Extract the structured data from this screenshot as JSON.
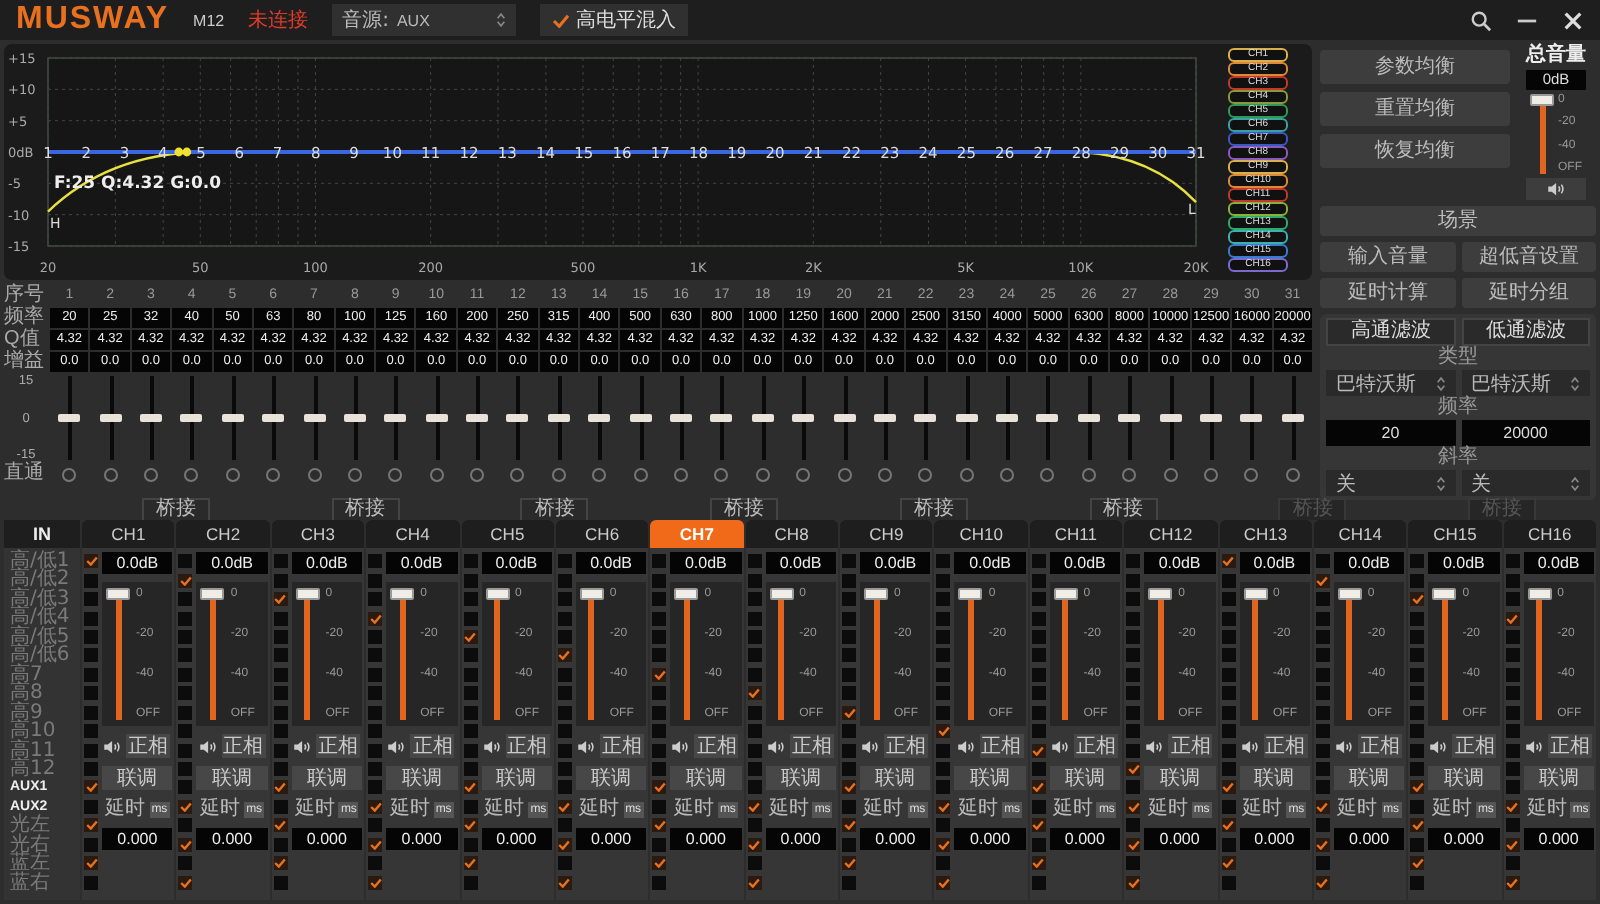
{
  "header": {
    "logo": "MUSWAY",
    "model": "M12",
    "status": "未连接",
    "source": {
      "label": "音源:",
      "value": "AUX"
    },
    "high_level_mix": {
      "label": "高电平混入",
      "checked": true
    }
  },
  "graph": {
    "y_labels": [
      "+15",
      "+10",
      "+5",
      "0dB",
      "-5",
      "-10",
      "-15"
    ],
    "x_labels": [
      "20",
      "50",
      "100",
      "200",
      "500",
      "1K",
      "2K",
      "5K",
      "10K",
      "20K"
    ],
    "readout": "F:25 Q:4.32 G:0.0",
    "hpf_marker": "H",
    "lpf_marker": "L",
    "band_labels": [
      "1",
      "2",
      "3",
      "4",
      "5",
      "6",
      "7",
      "8",
      "9",
      "10",
      "11",
      "12",
      "13",
      "14",
      "15",
      "16",
      "17",
      "18",
      "19",
      "20",
      "21",
      "22",
      "23",
      "24",
      "25",
      "26",
      "27",
      "28",
      "29",
      "30",
      "31"
    ]
  },
  "channel_legend": [
    {
      "label": "CH1",
      "color": "#d8b04a"
    },
    {
      "label": "CH2",
      "color": "#e0883a"
    },
    {
      "label": "CH3",
      "color": "#c0392b"
    },
    {
      "label": "CH4",
      "color": "#8a9a3a"
    },
    {
      "label": "CH5",
      "color": "#2e9a5a"
    },
    {
      "label": "CH6",
      "color": "#3aa0a0"
    },
    {
      "label": "CH7",
      "color": "#3a5ac0"
    },
    {
      "label": "CH8",
      "color": "#8a5ac0"
    },
    {
      "label": "CH9",
      "color": "#d8b04a"
    },
    {
      "label": "CH10",
      "color": "#e0883a"
    },
    {
      "label": "CH11",
      "color": "#c0392b"
    },
    {
      "label": "CH12",
      "color": "#8ab03a"
    },
    {
      "label": "CH13",
      "color": "#2eaa6a"
    },
    {
      "label": "CH14",
      "color": "#3ab0b0"
    },
    {
      "label": "CH15",
      "color": "#3a7ad0"
    },
    {
      "label": "CH16",
      "color": "#7a6ad0"
    }
  ],
  "eq_actions": [
    "参数均衡",
    "重置均衡",
    "恢复均衡"
  ],
  "master_volume": {
    "title": "总音量",
    "reading": "0dB",
    "level": 1,
    "scale": [
      "0",
      "-20",
      "-40",
      "OFF"
    ]
  },
  "scene_button": "场景",
  "tool_buttons": [
    "输入音量",
    "超低音设置",
    "延时计算",
    "延时分组"
  ],
  "filter": {
    "tabs": [
      "高通滤波",
      "低通滤波"
    ],
    "type_label": "类型",
    "types": [
      "巴特沃斯",
      "巴特沃斯"
    ],
    "freq_label": "频率",
    "freqs": [
      "20",
      "20000"
    ],
    "slope_label": "斜率",
    "slopes": [
      "关",
      "关"
    ]
  },
  "eq_table": {
    "row_labels": [
      "序号",
      "频率",
      "Q值",
      "增益"
    ],
    "scale": [
      "15",
      "0",
      "-15"
    ],
    "bypass_label": "直通",
    "bands": [
      {
        "number": "1",
        "freq": "20",
        "q": "4.32",
        "gain": "0.0",
        "level": 0.5,
        "bypass": false
      },
      {
        "number": "2",
        "freq": "25",
        "q": "4.32",
        "gain": "0.0",
        "level": 0.5,
        "bypass": false
      },
      {
        "number": "3",
        "freq": "32",
        "q": "4.32",
        "gain": "0.0",
        "level": 0.5,
        "bypass": false
      },
      {
        "number": "4",
        "freq": "40",
        "q": "4.32",
        "gain": "0.0",
        "level": 0.5,
        "bypass": false
      },
      {
        "number": "5",
        "freq": "50",
        "q": "4.32",
        "gain": "0.0",
        "level": 0.5,
        "bypass": false
      },
      {
        "number": "6",
        "freq": "63",
        "q": "4.32",
        "gain": "0.0",
        "level": 0.5,
        "bypass": false
      },
      {
        "number": "7",
        "freq": "80",
        "q": "4.32",
        "gain": "0.0",
        "level": 0.5,
        "bypass": false
      },
      {
        "number": "8",
        "freq": "100",
        "q": "4.32",
        "gain": "0.0",
        "level": 0.5,
        "bypass": false
      },
      {
        "number": "9",
        "freq": "125",
        "q": "4.32",
        "gain": "0.0",
        "level": 0.5,
        "bypass": false
      },
      {
        "number": "10",
        "freq": "160",
        "q": "4.32",
        "gain": "0.0",
        "level": 0.5,
        "bypass": false
      },
      {
        "number": "11",
        "freq": "200",
        "q": "4.32",
        "gain": "0.0",
        "level": 0.5,
        "bypass": false
      },
      {
        "number": "12",
        "freq": "250",
        "q": "4.32",
        "gain": "0.0",
        "level": 0.5,
        "bypass": false
      },
      {
        "number": "13",
        "freq": "315",
        "q": "4.32",
        "gain": "0.0",
        "level": 0.5,
        "bypass": false
      },
      {
        "number": "14",
        "freq": "400",
        "q": "4.32",
        "gain": "0.0",
        "level": 0.5,
        "bypass": false
      },
      {
        "number": "15",
        "freq": "500",
        "q": "4.32",
        "gain": "0.0",
        "level": 0.5,
        "bypass": false
      },
      {
        "number": "16",
        "freq": "630",
        "q": "4.32",
        "gain": "0.0",
        "level": 0.5,
        "bypass": false
      },
      {
        "number": "17",
        "freq": "800",
        "q": "4.32",
        "gain": "0.0",
        "level": 0.5,
        "bypass": false
      },
      {
        "number": "18",
        "freq": "1000",
        "q": "4.32",
        "gain": "0.0",
        "level": 0.5,
        "bypass": false
      },
      {
        "number": "19",
        "freq": "1250",
        "q": "4.32",
        "gain": "0.0",
        "level": 0.5,
        "bypass": false
      },
      {
        "number": "20",
        "freq": "1600",
        "q": "4.32",
        "gain": "0.0",
        "level": 0.5,
        "bypass": false
      },
      {
        "number": "21",
        "freq": "2000",
        "q": "4.32",
        "gain": "0.0",
        "level": 0.5,
        "bypass": false
      },
      {
        "number": "22",
        "freq": "2500",
        "q": "4.32",
        "gain": "0.0",
        "level": 0.5,
        "bypass": false
      },
      {
        "number": "23",
        "freq": "3150",
        "q": "4.32",
        "gain": "0.0",
        "level": 0.5,
        "bypass": false
      },
      {
        "number": "24",
        "freq": "4000",
        "q": "4.32",
        "gain": "0.0",
        "level": 0.5,
        "bypass": false
      },
      {
        "number": "25",
        "freq": "5000",
        "q": "4.32",
        "gain": "0.0",
        "level": 0.5,
        "bypass": false
      },
      {
        "number": "26",
        "freq": "6300",
        "q": "4.32",
        "gain": "0.0",
        "level": 0.5,
        "bypass": false
      },
      {
        "number": "27",
        "freq": "8000",
        "q": "4.32",
        "gain": "0.0",
        "level": 0.5,
        "bypass": false
      },
      {
        "number": "28",
        "freq": "10000",
        "q": "4.32",
        "gain": "0.0",
        "level": 0.5,
        "bypass": false
      },
      {
        "number": "29",
        "freq": "12500",
        "q": "4.32",
        "gain": "0.0",
        "level": 0.5,
        "bypass": false
      },
      {
        "number": "30",
        "freq": "16000",
        "q": "4.32",
        "gain": "0.0",
        "level": 0.5,
        "bypass": false
      },
      {
        "number": "31",
        "freq": "20000",
        "q": "4.32",
        "gain": "0.0",
        "level": 0.5,
        "bypass": false
      }
    ]
  },
  "bridges": [
    {
      "label": "桥接",
      "disabled": false
    },
    {
      "label": "桥接",
      "disabled": false
    },
    {
      "label": "桥接",
      "disabled": false
    },
    {
      "label": "桥接",
      "disabled": false
    },
    {
      "label": "桥接",
      "disabled": false
    },
    {
      "label": "桥接",
      "disabled": false
    },
    {
      "label": "桥接",
      "disabled": true
    },
    {
      "label": "桥接",
      "disabled": true
    }
  ],
  "inputs": {
    "title": "IN",
    "items": [
      {
        "label": "高/低1",
        "active": false
      },
      {
        "label": "高/低2",
        "active": false
      },
      {
        "label": "高/低3",
        "active": false
      },
      {
        "label": "高/低4",
        "active": false
      },
      {
        "label": "高/低5",
        "active": false
      },
      {
        "label": "高/低6",
        "active": false
      },
      {
        "label": "高7",
        "active": false
      },
      {
        "label": "高8",
        "active": false
      },
      {
        "label": "高9",
        "active": false
      },
      {
        "label": "高10",
        "active": false
      },
      {
        "label": "高11",
        "active": false
      },
      {
        "label": "高12",
        "active": false
      },
      {
        "label": "AUX1",
        "active": true
      },
      {
        "label": "AUX2",
        "active": true
      },
      {
        "label": "光左",
        "active": false
      },
      {
        "label": "光右",
        "active": false
      },
      {
        "label": "蓝左",
        "active": false
      },
      {
        "label": "蓝右",
        "active": false
      }
    ]
  },
  "channels": [
    {
      "name": "CH1",
      "selected": false,
      "volume": "0.0dB",
      "level": 1,
      "scale": [
        "0",
        "-20",
        "-40",
        "OFF"
      ],
      "phase": "正相",
      "link": "联调",
      "delay_label": "延时",
      "delay_unit": "ms",
      "delay": "0.000",
      "routes": [
        true,
        false,
        false,
        false,
        false,
        false,
        false,
        false,
        false,
        false,
        false,
        false,
        true,
        false,
        true,
        false,
        true,
        false
      ]
    },
    {
      "name": "CH2",
      "selected": false,
      "volume": "0.0dB",
      "level": 1,
      "scale": [
        "0",
        "-20",
        "-40",
        "OFF"
      ],
      "phase": "正相",
      "link": "联调",
      "delay_label": "延时",
      "delay_unit": "ms",
      "delay": "0.000",
      "routes": [
        false,
        true,
        false,
        false,
        false,
        false,
        false,
        false,
        false,
        false,
        false,
        false,
        false,
        true,
        false,
        true,
        false,
        true
      ]
    },
    {
      "name": "CH3",
      "selected": false,
      "volume": "0.0dB",
      "level": 1,
      "scale": [
        "0",
        "-20",
        "-40",
        "OFF"
      ],
      "phase": "正相",
      "link": "联调",
      "delay_label": "延时",
      "delay_unit": "ms",
      "delay": "0.000",
      "routes": [
        false,
        false,
        true,
        false,
        false,
        false,
        false,
        false,
        false,
        false,
        false,
        false,
        true,
        false,
        true,
        false,
        true,
        false
      ]
    },
    {
      "name": "CH4",
      "selected": false,
      "volume": "0.0dB",
      "level": 1,
      "scale": [
        "0",
        "-20",
        "-40",
        "OFF"
      ],
      "phase": "正相",
      "link": "联调",
      "delay_label": "延时",
      "delay_unit": "ms",
      "delay": "0.000",
      "routes": [
        false,
        false,
        false,
        true,
        false,
        false,
        false,
        false,
        false,
        false,
        false,
        false,
        false,
        true,
        false,
        true,
        false,
        true
      ]
    },
    {
      "name": "CH5",
      "selected": false,
      "volume": "0.0dB",
      "level": 1,
      "scale": [
        "0",
        "-20",
        "-40",
        "OFF"
      ],
      "phase": "正相",
      "link": "联调",
      "delay_label": "延时",
      "delay_unit": "ms",
      "delay": "0.000",
      "routes": [
        false,
        false,
        false,
        false,
        true,
        false,
        false,
        false,
        false,
        false,
        false,
        false,
        true,
        false,
        true,
        false,
        true,
        false
      ]
    },
    {
      "name": "CH6",
      "selected": false,
      "volume": "0.0dB",
      "level": 1,
      "scale": [
        "0",
        "-20",
        "-40",
        "OFF"
      ],
      "phase": "正相",
      "link": "联调",
      "delay_label": "延时",
      "delay_unit": "ms",
      "delay": "0.000",
      "routes": [
        false,
        false,
        false,
        false,
        false,
        true,
        false,
        false,
        false,
        false,
        false,
        false,
        false,
        true,
        false,
        true,
        false,
        true
      ]
    },
    {
      "name": "CH7",
      "selected": true,
      "volume": "0.0dB",
      "level": 1,
      "scale": [
        "0",
        "-20",
        "-40",
        "OFF"
      ],
      "phase": "正相",
      "link": "联调",
      "delay_label": "延时",
      "delay_unit": "ms",
      "delay": "0.000",
      "routes": [
        false,
        false,
        false,
        false,
        false,
        false,
        true,
        false,
        false,
        false,
        false,
        false,
        true,
        false,
        true,
        false,
        true,
        false
      ]
    },
    {
      "name": "CH8",
      "selected": false,
      "volume": "0.0dB",
      "level": 1,
      "scale": [
        "0",
        "-20",
        "-40",
        "OFF"
      ],
      "phase": "正相",
      "link": "联调",
      "delay_label": "延时",
      "delay_unit": "ms",
      "delay": "0.000",
      "routes": [
        false,
        false,
        false,
        false,
        false,
        false,
        false,
        true,
        false,
        false,
        false,
        false,
        false,
        true,
        false,
        true,
        false,
        true
      ]
    },
    {
      "name": "CH9",
      "selected": false,
      "volume": "0.0dB",
      "level": 1,
      "scale": [
        "0",
        "-20",
        "-40",
        "OFF"
      ],
      "phase": "正相",
      "link": "联调",
      "delay_label": "延时",
      "delay_unit": "ms",
      "delay": "0.000",
      "routes": [
        false,
        false,
        false,
        false,
        false,
        false,
        false,
        false,
        true,
        false,
        false,
        false,
        true,
        false,
        true,
        false,
        true,
        false
      ]
    },
    {
      "name": "CH10",
      "selected": false,
      "volume": "0.0dB",
      "level": 1,
      "scale": [
        "0",
        "-20",
        "-40",
        "OFF"
      ],
      "phase": "正相",
      "link": "联调",
      "delay_label": "延时",
      "delay_unit": "ms",
      "delay": "0.000",
      "routes": [
        false,
        false,
        false,
        false,
        false,
        false,
        false,
        false,
        false,
        true,
        false,
        false,
        false,
        true,
        false,
        true,
        false,
        true
      ]
    },
    {
      "name": "CH11",
      "selected": false,
      "volume": "0.0dB",
      "level": 1,
      "scale": [
        "0",
        "-20",
        "-40",
        "OFF"
      ],
      "phase": "正相",
      "link": "联调",
      "delay_label": "延时",
      "delay_unit": "ms",
      "delay": "0.000",
      "routes": [
        false,
        false,
        false,
        false,
        false,
        false,
        false,
        false,
        false,
        false,
        true,
        false,
        true,
        false,
        true,
        false,
        true,
        false
      ]
    },
    {
      "name": "CH12",
      "selected": false,
      "volume": "0.0dB",
      "level": 1,
      "scale": [
        "0",
        "-20",
        "-40",
        "OFF"
      ],
      "phase": "正相",
      "link": "联调",
      "delay_label": "延时",
      "delay_unit": "ms",
      "delay": "0.000",
      "routes": [
        false,
        false,
        false,
        false,
        false,
        false,
        false,
        false,
        false,
        false,
        false,
        true,
        false,
        true,
        false,
        true,
        false,
        true
      ]
    },
    {
      "name": "CH13",
      "selected": false,
      "volume": "0.0dB",
      "level": 1,
      "scale": [
        "0",
        "-20",
        "-40",
        "OFF"
      ],
      "phase": "正相",
      "link": "联调",
      "delay_label": "延时",
      "delay_unit": "ms",
      "delay": "0.000",
      "routes": [
        true,
        false,
        false,
        false,
        false,
        false,
        false,
        false,
        false,
        false,
        false,
        false,
        true,
        false,
        true,
        false,
        true,
        false
      ]
    },
    {
      "name": "CH14",
      "selected": false,
      "volume": "0.0dB",
      "level": 1,
      "scale": [
        "0",
        "-20",
        "-40",
        "OFF"
      ],
      "phase": "正相",
      "link": "联调",
      "delay_label": "延时",
      "delay_unit": "ms",
      "delay": "0.000",
      "routes": [
        false,
        true,
        false,
        false,
        false,
        false,
        false,
        false,
        false,
        false,
        false,
        false,
        false,
        true,
        false,
        true,
        false,
        true
      ]
    },
    {
      "name": "CH15",
      "selected": false,
      "volume": "0.0dB",
      "level": 1,
      "scale": [
        "0",
        "-20",
        "-40",
        "OFF"
      ],
      "phase": "正相",
      "link": "联调",
      "delay_label": "延时",
      "delay_unit": "ms",
      "delay": "0.000",
      "routes": [
        false,
        false,
        true,
        false,
        false,
        false,
        false,
        false,
        false,
        false,
        false,
        false,
        true,
        false,
        true,
        false,
        true,
        false
      ]
    },
    {
      "name": "CH16",
      "selected": false,
      "volume": "0.0dB",
      "level": 1,
      "scale": [
        "0",
        "-20",
        "-40",
        "OFF"
      ],
      "phase": "正相",
      "link": "联调",
      "delay_label": "延时",
      "delay_unit": "ms",
      "delay": "0.000",
      "routes": [
        false,
        false,
        false,
        true,
        false,
        false,
        false,
        false,
        false,
        false,
        false,
        false,
        false,
        true,
        false,
        true,
        false,
        true
      ]
    }
  ]
}
